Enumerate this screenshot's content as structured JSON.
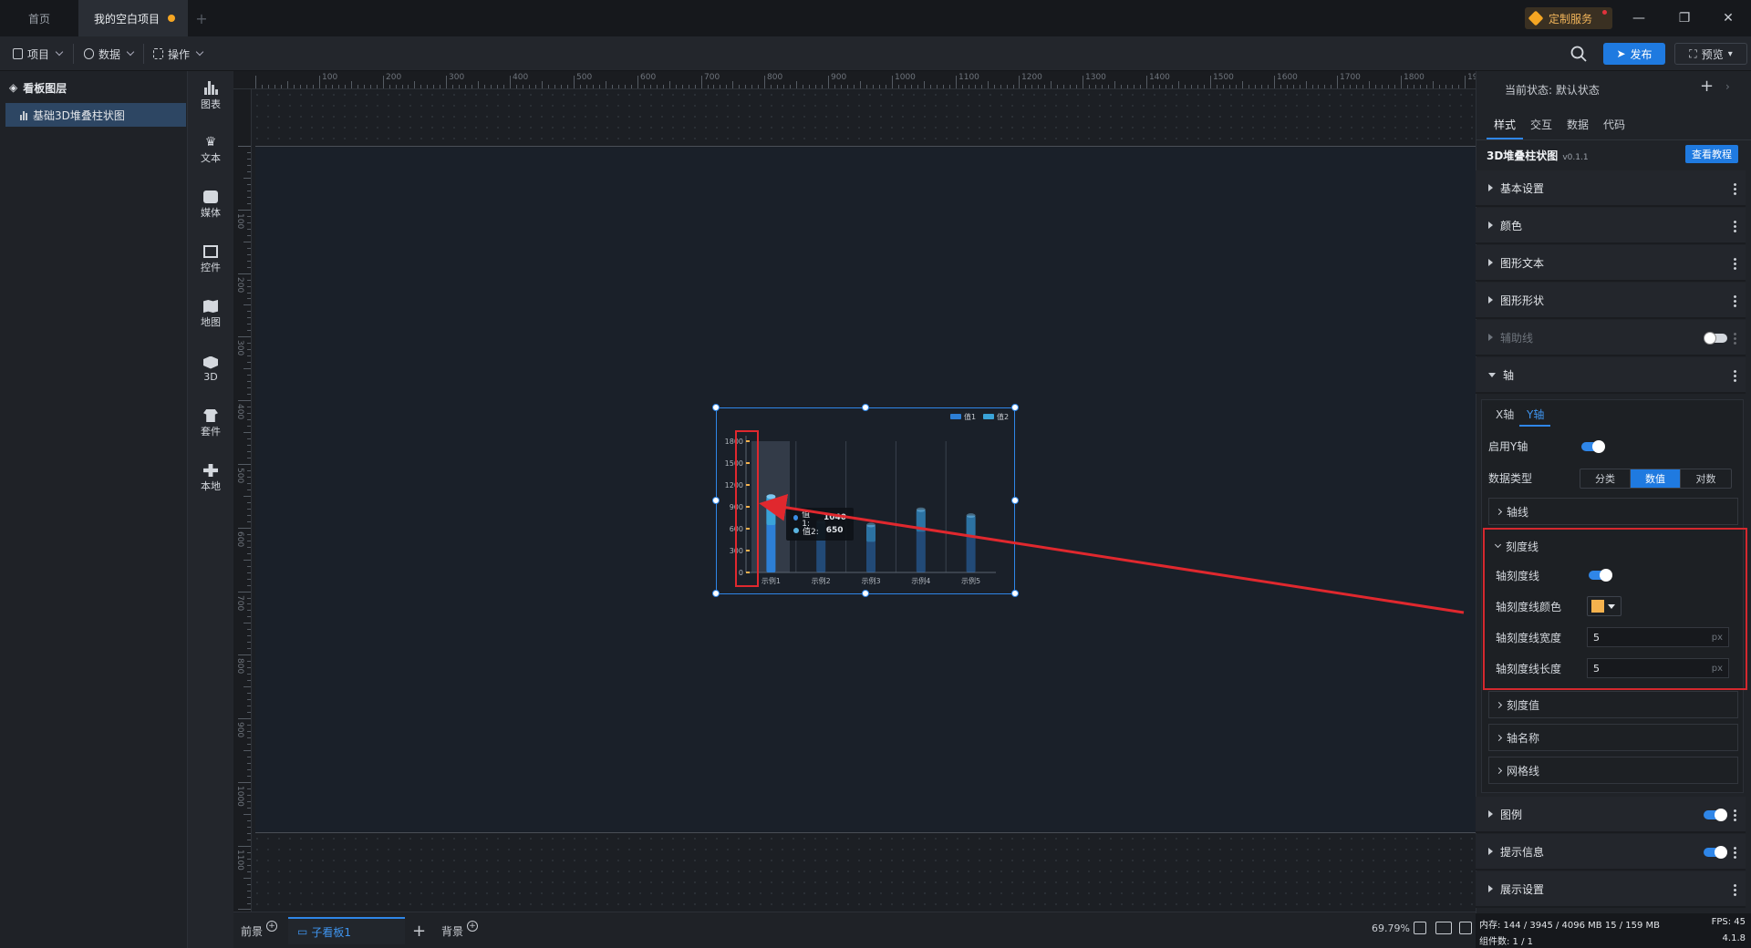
{
  "titlebar": {
    "tabs": [
      "首页",
      "我的空白项目"
    ],
    "custom_service": "定制服务",
    "win": {
      "minimize": "—",
      "restore": "❐",
      "close": "✕"
    }
  },
  "menubar": {
    "items": [
      "项目",
      "数据",
      "操作"
    ],
    "publish": "发布",
    "preview": "预览"
  },
  "layers": {
    "title": "看板图层",
    "items": [
      "基础3D堆叠柱状图"
    ]
  },
  "rail": [
    "图表",
    "文本",
    "媒体",
    "控件",
    "地图",
    "3D",
    "套件",
    "本地"
  ],
  "ruler": {
    "x": [
      "100",
      "200",
      "300",
      "400",
      "500",
      "600",
      "700",
      "800",
      "900",
      "1000",
      "1100",
      "1200",
      "1300",
      "1400",
      "1500",
      "1600",
      "1700",
      "1800",
      "1900"
    ],
    "y": [
      "100",
      "200",
      "300",
      "400",
      "500",
      "600",
      "700",
      "800",
      "900",
      "1000",
      "1100"
    ]
  },
  "chart_data": {
    "type": "bar",
    "categories": [
      "示例1",
      "示例2",
      "示例3",
      "示例4",
      "示例5"
    ],
    "yticks": [
      "0",
      "300",
      "600",
      "900",
      "1200",
      "1500",
      "1800"
    ],
    "ylim": [
      0,
      1800
    ],
    "series": [
      {
        "name": "值1",
        "values": [
          1040,
          700,
          650,
          860,
          780
        ]
      },
      {
        "name": "值2",
        "values": [
          650,
          450,
          420,
          560,
          500
        ]
      }
    ],
    "legend": "top-right",
    "colors": {
      "series1": "#2d7fd6",
      "series2": "#3aa3d8",
      "tick": "#f5b24e"
    },
    "tooltip": {
      "label1": "值1:",
      "value1": "1040",
      "label2": "值2:",
      "value2": "650"
    }
  },
  "bottombar": {
    "tabs": [
      "前景",
      "子看板1",
      "背景"
    ],
    "zoom": "69.79%"
  },
  "panel": {
    "state_label": "当前状态: 默认状态",
    "tabs": [
      "样式",
      "交互",
      "数据",
      "代码"
    ],
    "component": "3D堆叠柱状图",
    "version": "v0.1.1",
    "tutorial": "查看教程",
    "sections_top": [
      "基本设置",
      "颜色",
      "图形文本",
      "图形形状",
      "辅助线",
      "轴"
    ],
    "axis_tabs": [
      "X轴",
      "Y轴"
    ],
    "enable_y": "启用Y轴",
    "data_type": "数据类型",
    "data_type_options": [
      "分类",
      "数值",
      "对数"
    ],
    "sub_axisline": "轴线",
    "sub_tick": "刻度线",
    "tick_show": "轴刻度线",
    "tick_color": "轴刻度线颜色",
    "tick_width": "轴刻度线宽度",
    "tick_length": "轴刻度线长度",
    "tick_width_val": "5",
    "tick_length_val": "5",
    "unit": "px",
    "sub_more": [
      "刻度值",
      "轴名称",
      "网格线"
    ],
    "sections_bottom": [
      "图例",
      "提示信息",
      "展示设置"
    ]
  },
  "status": {
    "memory": "内存: 144 / 3945 / 4096 MB  15 / 159 MB",
    "fps": "FPS: 45",
    "count": "组件数: 1 / 1",
    "version": "4.1.8"
  }
}
